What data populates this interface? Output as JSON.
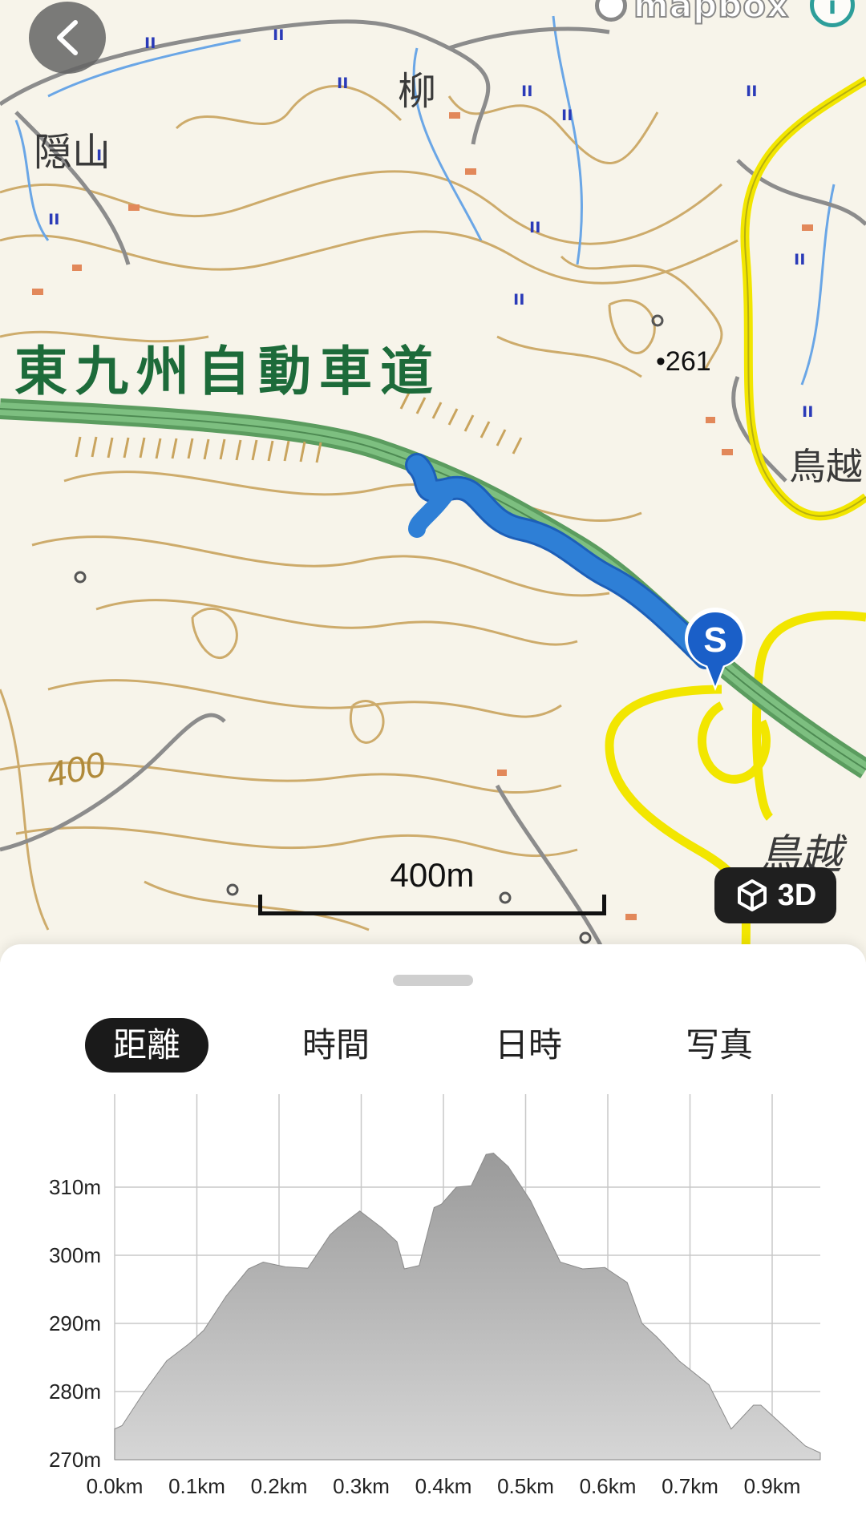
{
  "map": {
    "attribution": "mapbox",
    "place_labels": [
      "隠山",
      "柳",
      "鳥越",
      "鳥越"
    ],
    "highway_label": "東九州自動車道",
    "spot_height": "•261",
    "contour_label": "400",
    "scale_label": "400m",
    "view_3d_label": "3D",
    "start_marker_label": "S",
    "colors": {
      "route": "#2e7fd6",
      "highway": "#6aae6d",
      "road": "#f2e600",
      "contour": "#c9a45e",
      "marker": "#1a5fc8"
    }
  },
  "sheet": {
    "tabs": [
      {
        "label": "距離",
        "active": true
      },
      {
        "label": "時間",
        "active": false
      },
      {
        "label": "日時",
        "active": false
      },
      {
        "label": "写真",
        "active": false
      }
    ]
  },
  "chart_data": {
    "type": "area",
    "ylim": [
      270,
      315
    ],
    "y_tick_labels": [
      "270m",
      "280m",
      "290m",
      "300m",
      "310m"
    ],
    "x_tick_labels": [
      "0.0km",
      "0.1km",
      "0.2km",
      "0.3km",
      "0.4km",
      "0.5km",
      "0.6km",
      "0.7km",
      "0.9km"
    ],
    "x": [
      0,
      0.01,
      0.04,
      0.07,
      0.1,
      0.12,
      0.15,
      0.18,
      0.2,
      0.23,
      0.26,
      0.29,
      0.3,
      0.33,
      0.36,
      0.38,
      0.39,
      0.41,
      0.43,
      0.44,
      0.46,
      0.48,
      0.5,
      0.51,
      0.53,
      0.56,
      0.6,
      0.63,
      0.66,
      0.69,
      0.71,
      0.73,
      0.76,
      0.8,
      0.83,
      0.86,
      0.87,
      0.89,
      0.91,
      0.93,
      0.95
    ],
    "y": [
      274.5,
      275,
      280,
      284.5,
      287,
      289,
      294,
      298,
      299,
      298.3,
      298.1,
      303,
      304,
      306.5,
      304,
      302,
      298,
      298.5,
      307,
      307.5,
      310,
      310.2,
      314.8,
      315,
      313,
      308,
      299,
      298,
      298.2,
      296,
      290,
      288,
      284.5,
      281,
      274.5,
      278,
      278,
      276,
      274,
      272,
      271
    ]
  }
}
